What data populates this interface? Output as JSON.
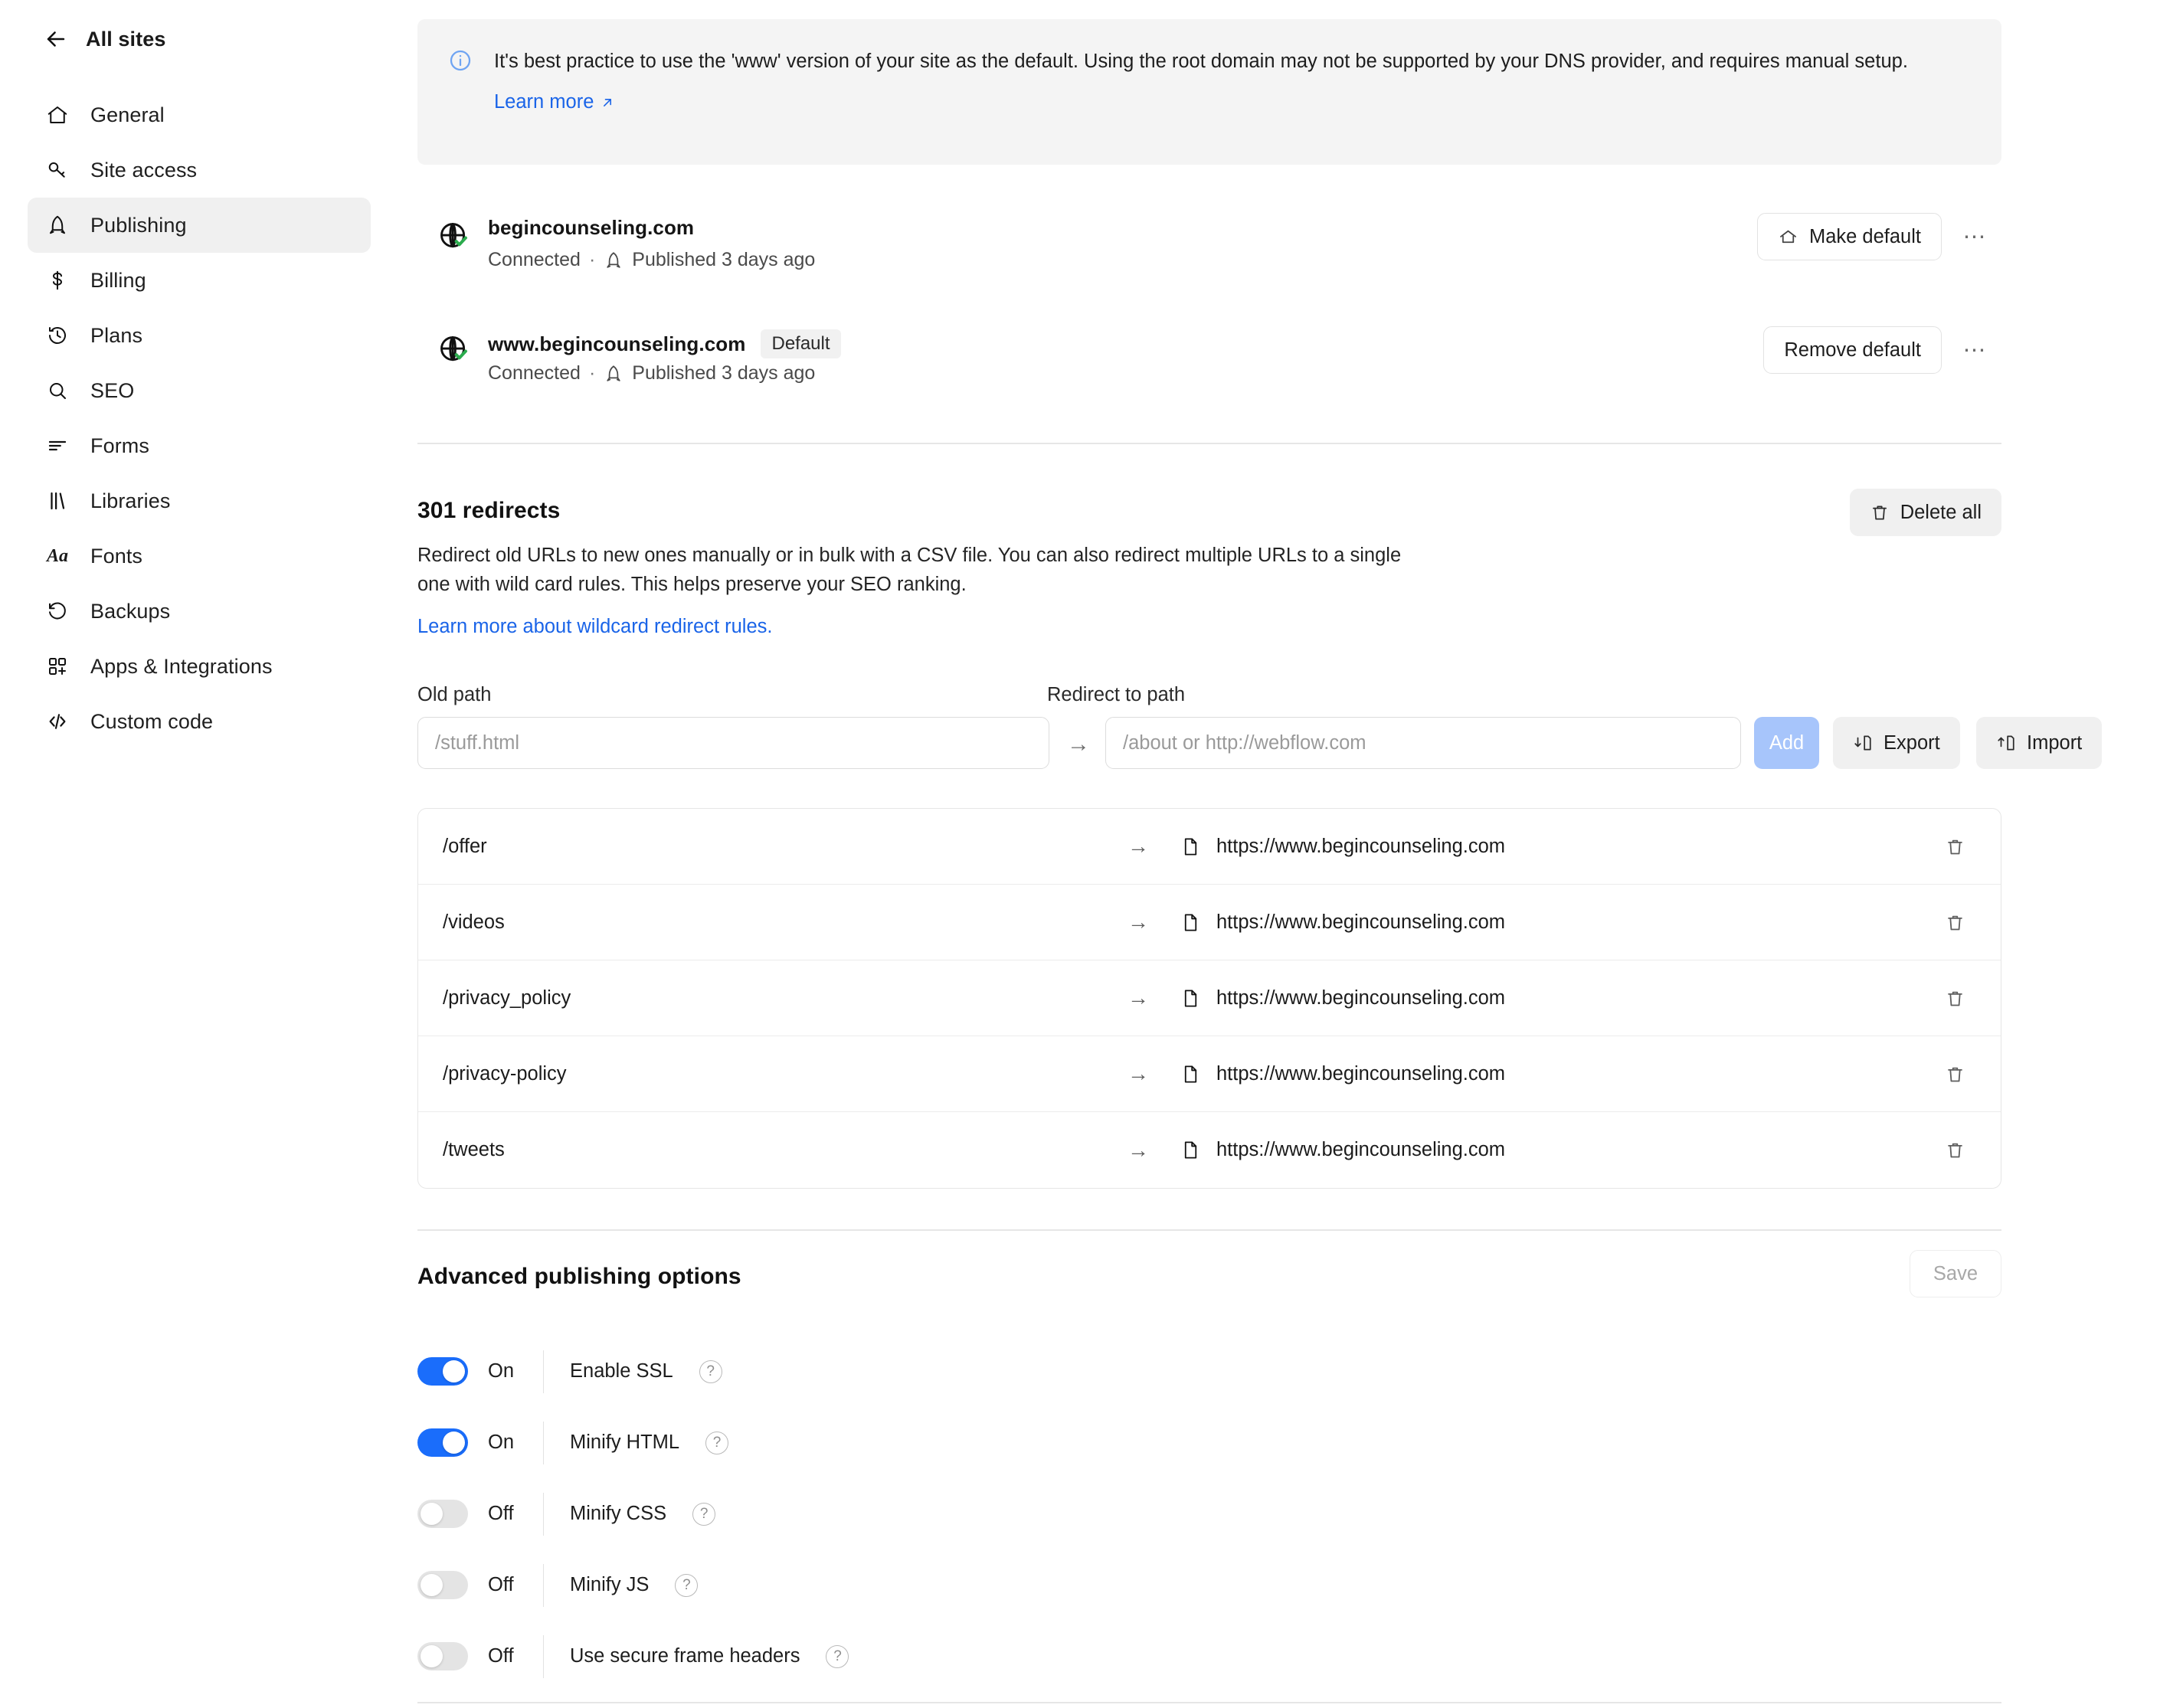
{
  "sidebar": {
    "back_label": "All sites",
    "items": [
      {
        "label": "General",
        "icon": "home-icon"
      },
      {
        "label": "Site access",
        "icon": "key-icon"
      },
      {
        "label": "Publishing",
        "icon": "rocket-icon"
      },
      {
        "label": "Billing",
        "icon": "dollar-icon"
      },
      {
        "label": "Plans",
        "icon": "clock-arrow-icon"
      },
      {
        "label": "SEO",
        "icon": "search-icon"
      },
      {
        "label": "Forms",
        "icon": "forms-icon"
      },
      {
        "label": "Libraries",
        "icon": "libraries-icon"
      },
      {
        "label": "Fonts",
        "icon": "fonts-icon"
      },
      {
        "label": "Backups",
        "icon": "undo-icon"
      },
      {
        "label": "Apps & Integrations",
        "icon": "apps-plus-icon"
      },
      {
        "label": "Custom code",
        "icon": "code-icon"
      }
    ],
    "active": "Publishing"
  },
  "banner": {
    "icon": "info-icon",
    "text": "It's best practice to use the 'www' version of your site as the default. Using the root domain may not be supported by your DNS provider, and requires manual setup.",
    "link_label": "Learn more"
  },
  "domains": [
    {
      "name": "begincounseling.com",
      "badge": "",
      "status": "Connected",
      "separator": "·",
      "published": "Published 3 days ago",
      "action_label": "Make default",
      "action_icon": "home-icon",
      "menu_icon": "kebab-icon"
    },
    {
      "name": "www.begincounseling.com",
      "badge": "Default",
      "status": "Connected",
      "separator": "·",
      "published": "Published 3 days ago",
      "action_label": "Remove default",
      "action_icon": "",
      "menu_icon": "kebab-icon"
    }
  ],
  "redirects": {
    "title": "301 redirects",
    "description": "Redirect old URLs to new ones manually or in bulk with a CSV file. You can also redirect multiple URLs to a single one with wild card rules. This helps preserve your SEO ranking.",
    "link_label": "Learn more about wildcard redirect rules.",
    "delete_all_label": "Delete all",
    "form": {
      "old_path_label": "Old path",
      "old_path_placeholder": "/stuff.html",
      "old_path_value": "",
      "redirect_label": "Redirect to path",
      "redirect_placeholder": "/about or http://webflow.com",
      "redirect_value": "",
      "arrow": "→",
      "add_label": "Add",
      "export_label": "Export",
      "import_label": "Import"
    },
    "rows": [
      {
        "old": "/offer",
        "arrow": "→",
        "dest": "https://www.begincounseling.com"
      },
      {
        "old": "/videos",
        "arrow": "→",
        "dest": "https://www.begincounseling.com"
      },
      {
        "old": "/privacy_policy",
        "arrow": "→",
        "dest": "https://www.begincounseling.com"
      },
      {
        "old": "/privacy-policy",
        "arrow": "→",
        "dest": "https://www.begincounseling.com"
      },
      {
        "old": "/tweets",
        "arrow": "→",
        "dest": "https://www.begincounseling.com"
      }
    ]
  },
  "advanced": {
    "title": "Advanced publishing options",
    "save_label": "Save",
    "options": [
      {
        "state": "On",
        "on": true,
        "label": "Enable SSL",
        "help": "?"
      },
      {
        "state": "On",
        "on": true,
        "label": "Minify HTML",
        "help": "?"
      },
      {
        "state": "Off",
        "on": false,
        "label": "Minify CSS",
        "help": "?"
      },
      {
        "state": "Off",
        "on": false,
        "label": "Minify JS",
        "help": "?"
      },
      {
        "state": "Off",
        "on": false,
        "label": "Use secure frame headers",
        "help": "?"
      }
    ]
  },
  "colors": {
    "accent_blue": "#1a6dfb",
    "link_blue": "#1a64e8",
    "add_disabled_blue": "#a7c5fb",
    "connected_green": "#2bab4d",
    "panel_gray": "#f4f4f4"
  }
}
